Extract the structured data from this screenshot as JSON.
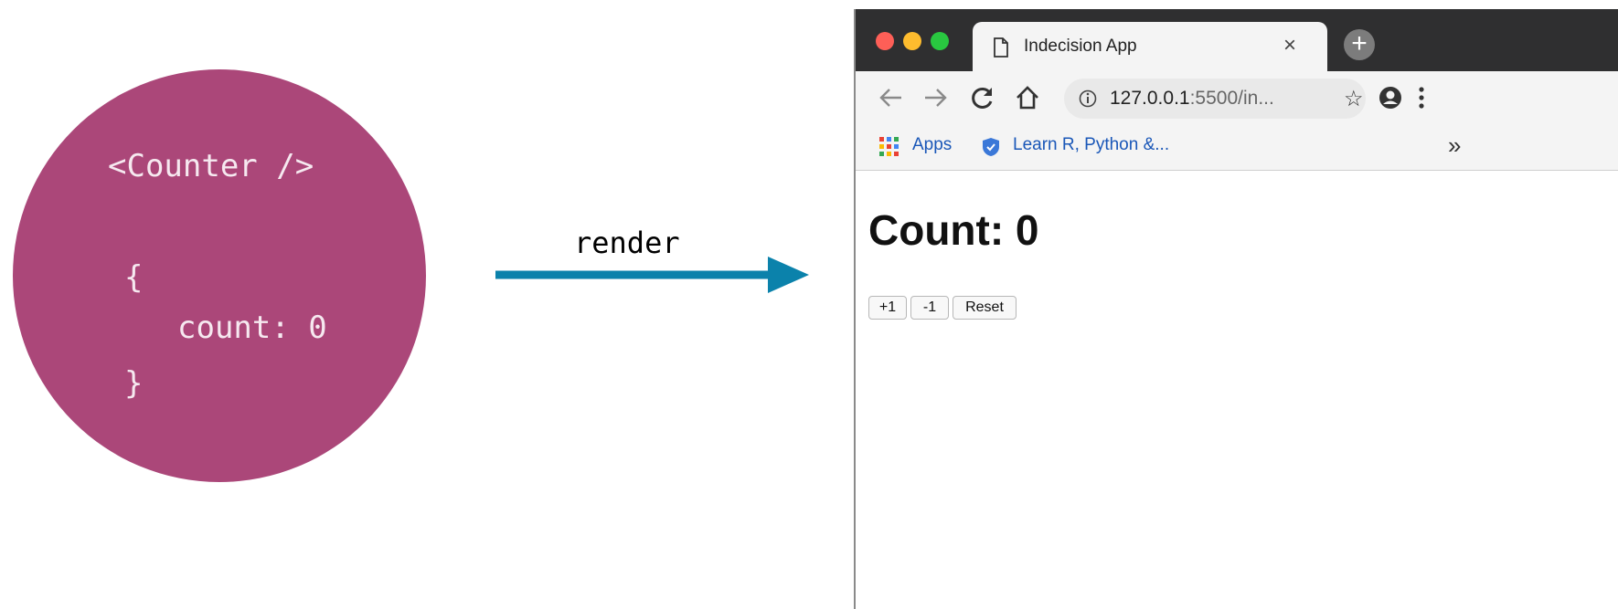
{
  "component": {
    "name": "<Counter />",
    "state_open": "{",
    "state_line": "count: 0",
    "state_close": "}",
    "color": "#ab4779"
  },
  "arrow": {
    "label": "render",
    "color": "#0b82ab"
  },
  "browser": {
    "tab_title": "Indecision App",
    "tab_close": "×",
    "new_tab": "+",
    "url_host": "127.0.0.1",
    "url_rest": ":5500/in...",
    "bookmarks": [
      {
        "label": "Apps",
        "icon": "apps-grid-icon"
      },
      {
        "label": "Learn R, Python &...",
        "icon": "shield-icon"
      }
    ],
    "overflow": "»",
    "icons": [
      "back-icon",
      "forward-icon",
      "reload-icon",
      "home-icon",
      "info-icon",
      "star-icon",
      "account-icon",
      "menu-icon"
    ]
  },
  "page": {
    "heading": "Count: 0",
    "buttons": {
      "increment": "+1",
      "decrement": "-1",
      "reset": "Reset"
    }
  }
}
